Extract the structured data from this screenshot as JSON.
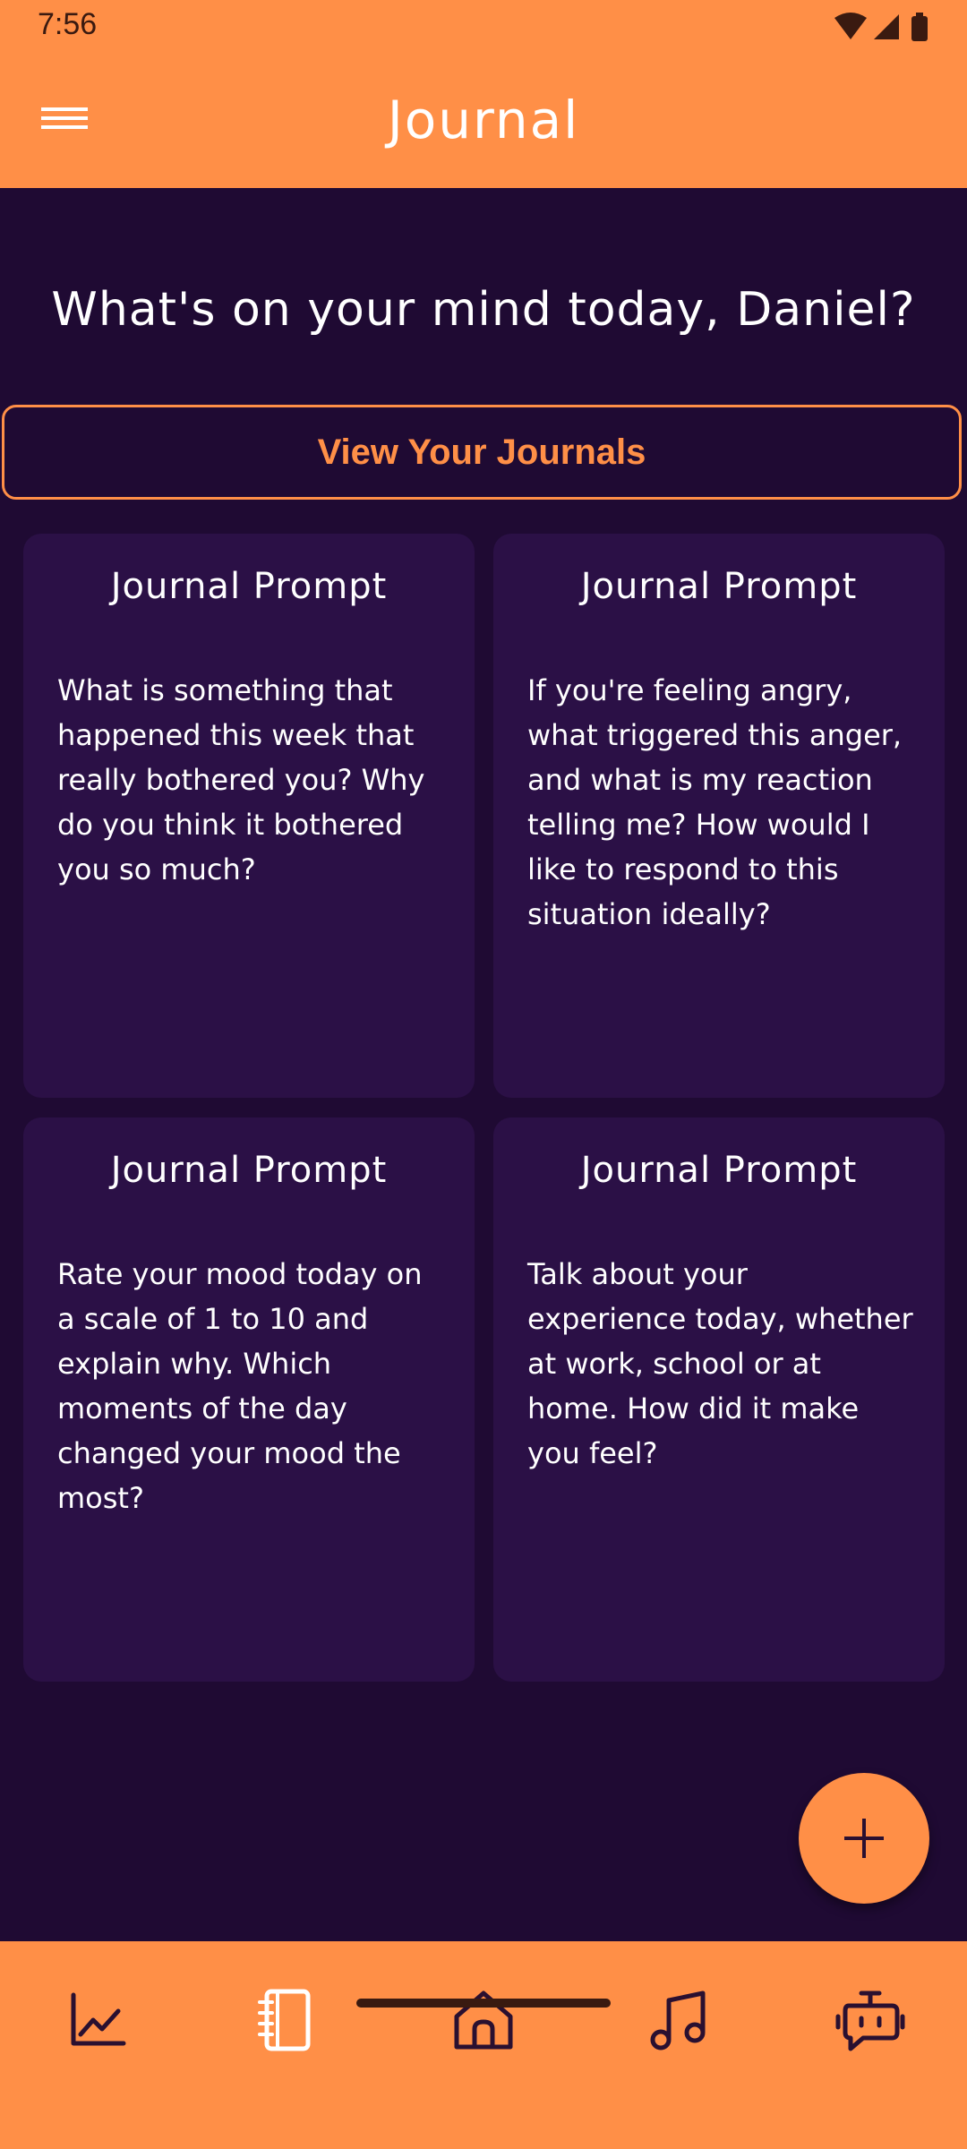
{
  "status_bar": {
    "time": "7:56"
  },
  "app_bar": {
    "title": "Journal",
    "menu_icon": "hamburger-menu-icon"
  },
  "greeting": "What's on your mind today, Daniel?",
  "view_journals_label": "View Your Journals",
  "prompts": [
    {
      "title": "Journal Prompt",
      "text": "What is something that happened this week that really bothered you? Why do you think it bothered you so much?"
    },
    {
      "title": "Journal Prompt",
      "text": "If you're feeling angry, what triggered this anger, and what is my reaction telling me? How would I like to respond to this situation ideally?"
    },
    {
      "title": "Journal Prompt",
      "text": "Rate your mood today on a scale of 1 to 10 and explain why. Which moments of the day changed your mood the most?"
    },
    {
      "title": "Journal Prompt",
      "text": "Talk about your experience today, whether at work, school or at home. How did it make you feel?"
    }
  ],
  "fab_icon": "plus-icon",
  "bottom_nav": [
    {
      "icon": "chart-icon",
      "active": false
    },
    {
      "icon": "journal-icon",
      "active": true
    },
    {
      "icon": "home-icon",
      "active": false
    },
    {
      "icon": "music-icon",
      "active": false
    },
    {
      "icon": "chatbot-icon",
      "active": false
    }
  ],
  "colors": {
    "accent": "#ff8f47",
    "background": "#1f0a33",
    "card": "#2b1046",
    "text": "#ffffff",
    "nav_icon": "#2a1030"
  }
}
